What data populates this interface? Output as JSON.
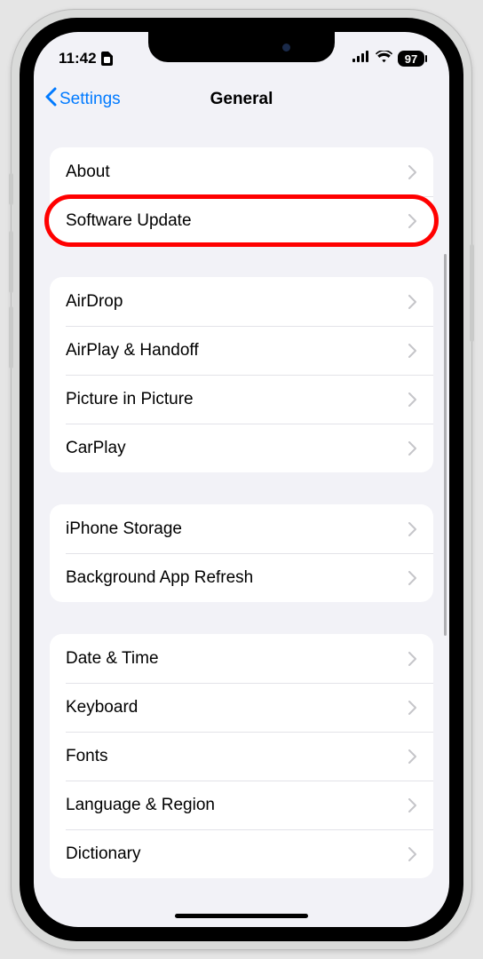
{
  "status": {
    "time": "11:42",
    "battery": "97"
  },
  "nav": {
    "back": "Settings",
    "title": "General"
  },
  "groups": [
    {
      "id": "g1",
      "rows": [
        {
          "id": "about",
          "label": "About"
        },
        {
          "id": "software-update",
          "label": "Software Update",
          "highlight": true
        }
      ]
    },
    {
      "id": "g2",
      "rows": [
        {
          "id": "airdrop",
          "label": "AirDrop"
        },
        {
          "id": "airplay-handoff",
          "label": "AirPlay & Handoff"
        },
        {
          "id": "picture-in-picture",
          "label": "Picture in Picture"
        },
        {
          "id": "carplay",
          "label": "CarPlay"
        }
      ]
    },
    {
      "id": "g3",
      "rows": [
        {
          "id": "iphone-storage",
          "label": "iPhone Storage"
        },
        {
          "id": "background-app-refresh",
          "label": "Background App Refresh"
        }
      ]
    },
    {
      "id": "g4",
      "rows": [
        {
          "id": "date-time",
          "label": "Date & Time"
        },
        {
          "id": "keyboard",
          "label": "Keyboard"
        },
        {
          "id": "fonts",
          "label": "Fonts"
        },
        {
          "id": "language-region",
          "label": "Language & Region"
        },
        {
          "id": "dictionary",
          "label": "Dictionary"
        }
      ]
    }
  ],
  "highlight_color": "#ff0000"
}
